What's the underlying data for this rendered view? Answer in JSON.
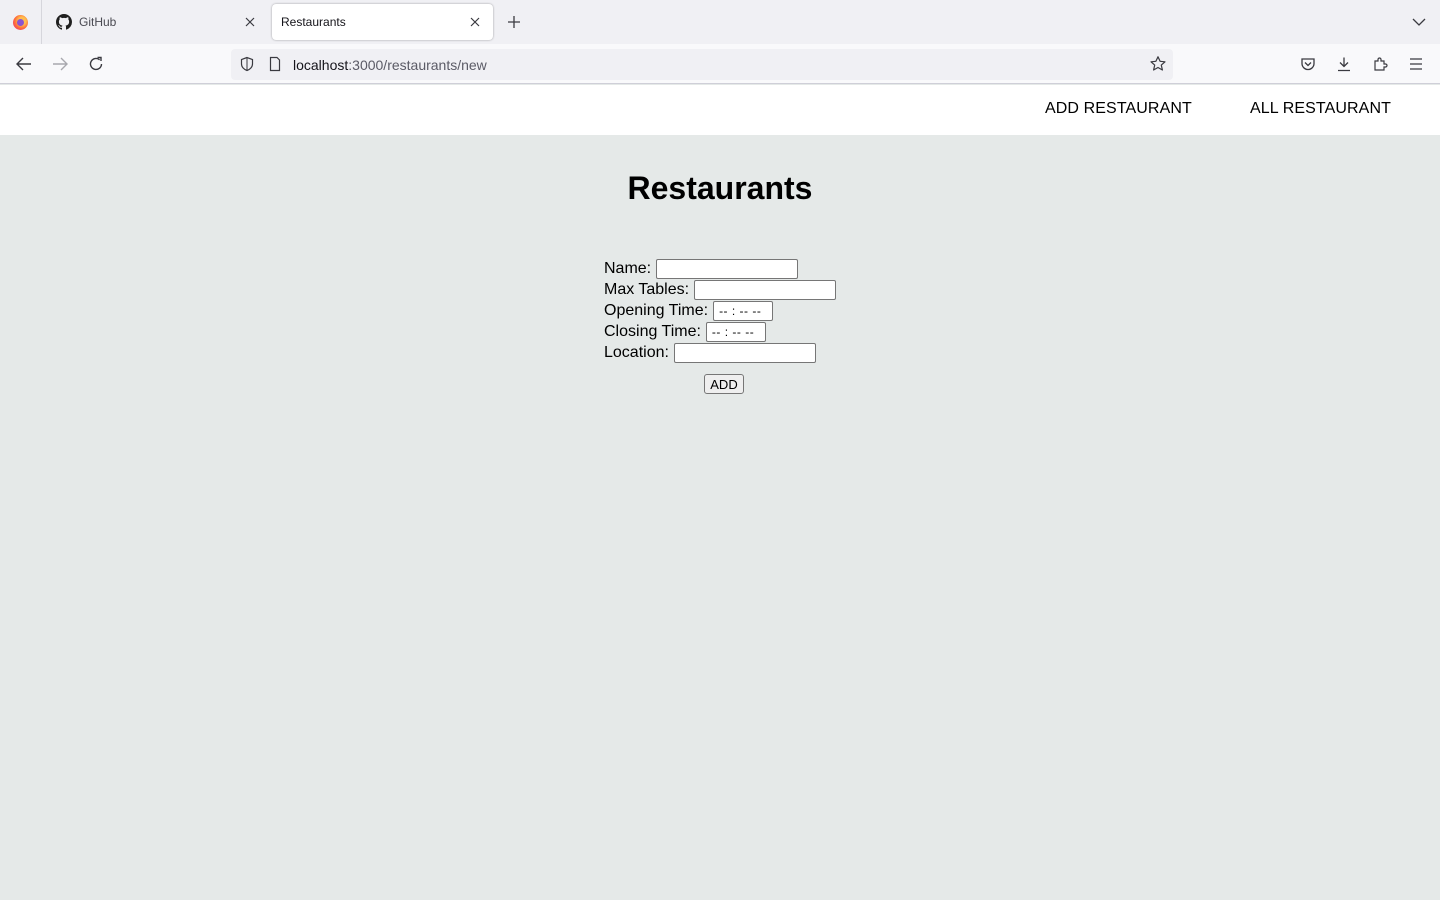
{
  "browser": {
    "tabs": [
      {
        "label": "GitHub",
        "icon": "github-icon"
      },
      {
        "label": "Restaurants",
        "active": true
      }
    ],
    "url_host": "localhost",
    "url_path": ":3000/restaurants/new"
  },
  "header": {
    "add_link": "ADD RESTAURANT",
    "all_link": "ALL RESTAURANT"
  },
  "page": {
    "title": "Restaurants"
  },
  "form": {
    "name_label": "Name:",
    "name_value": "",
    "max_tables_label": "Max Tables:",
    "max_tables_value": "",
    "opening_label": "Opening Time:",
    "opening_value": "-- : --  --",
    "closing_label": "Closing Time:",
    "closing_value": "-- : --  --",
    "location_label": "Location:",
    "location_value": "",
    "submit_label": "ADD"
  },
  "colors": {
    "page_background": "#e5e9e8",
    "header_background": "#ffffff"
  }
}
